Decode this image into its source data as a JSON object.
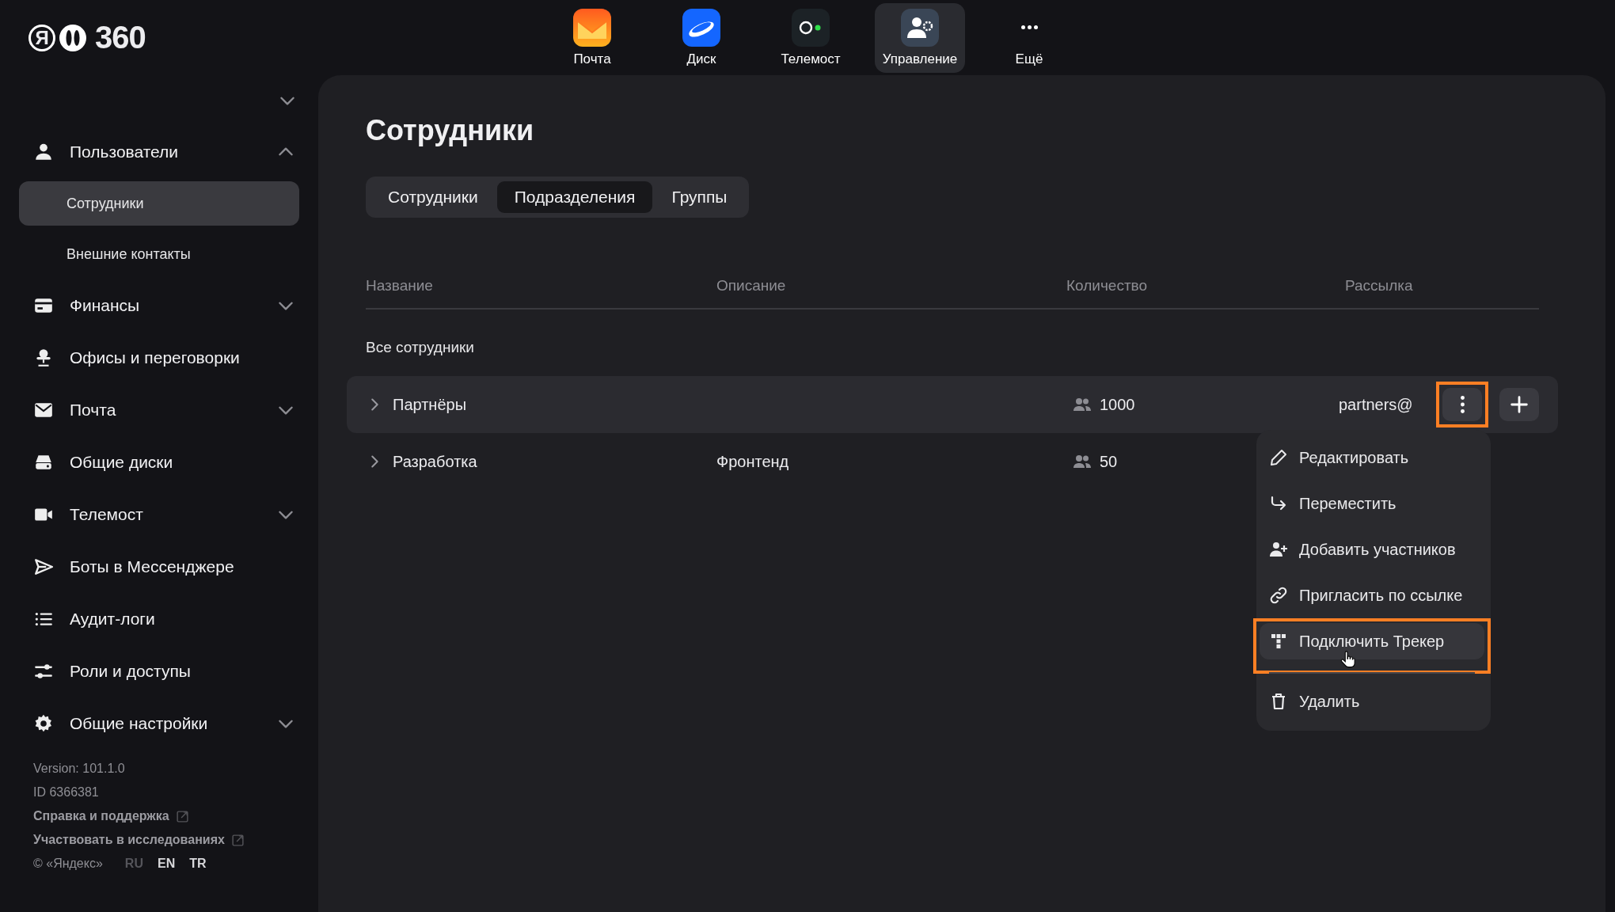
{
  "header": {
    "logo": {
      "letter": "Я",
      "text": "360"
    },
    "apps": [
      {
        "label": "Почта",
        "selected": false
      },
      {
        "label": "Диск",
        "selected": false
      },
      {
        "label": "Телемост",
        "selected": false
      },
      {
        "label": "Управление",
        "selected": true
      },
      {
        "label": "Ещё",
        "selected": false
      }
    ]
  },
  "sidebar": {
    "items": [
      {
        "label": "Пользователи",
        "kind": "group",
        "expanded": true,
        "children": [
          {
            "label": "Сотрудники",
            "selected": true
          },
          {
            "label": "Внешние контакты",
            "selected": false
          }
        ]
      },
      {
        "label": "Финансы",
        "kind": "group",
        "expanded": false
      },
      {
        "label": "Офисы и переговорки",
        "kind": "link"
      },
      {
        "label": "Почта",
        "kind": "group",
        "expanded": false
      },
      {
        "label": "Общие диски",
        "kind": "link"
      },
      {
        "label": "Телемост",
        "kind": "group",
        "expanded": false
      },
      {
        "label": "Боты в Мессенджере",
        "kind": "link"
      },
      {
        "label": "Аудит-логи",
        "kind": "link"
      },
      {
        "label": "Роли и доступы",
        "kind": "link"
      },
      {
        "label": "Общие настройки",
        "kind": "group",
        "expanded": false
      }
    ],
    "footer": {
      "version": "Version: 101.1.0",
      "id": "ID 6366381",
      "links": [
        {
          "label": "Справка и поддержка",
          "external": true
        },
        {
          "label": "Участвовать в исследованиях",
          "external": true
        }
      ],
      "copyright": "© «Яндекс»",
      "languages": [
        {
          "label": "RU",
          "selected": true
        },
        {
          "label": "EN",
          "selected": false
        },
        {
          "label": "TR",
          "selected": false
        }
      ]
    }
  },
  "main": {
    "title": "Сотрудники",
    "tabs": [
      {
        "label": "Сотрудники",
        "selected": false
      },
      {
        "label": "Подразделения",
        "selected": true
      },
      {
        "label": "Группы",
        "selected": false
      }
    ],
    "table": {
      "columns": [
        "Название",
        "Описание",
        "Количество",
        "Рассылка"
      ],
      "group_label": "Все сотрудники",
      "rows": [
        {
          "name": "Партнёры",
          "description": "",
          "count": "1000",
          "mailing": "partners@",
          "hovered": true,
          "annotated": true,
          "menu": [
            {
              "label": "Редактировать",
              "selected": false,
              "separated": false,
              "annotated": false
            },
            {
              "label": "Переместить",
              "selected": false,
              "separated": false,
              "annotated": false
            },
            {
              "label": "Добавить участников",
              "selected": false,
              "separated": false,
              "annotated": false
            },
            {
              "label": "Пригласить по ссылке",
              "selected": false,
              "separated": false,
              "annotated": false
            },
            {
              "label": "Подключить Трекер",
              "selected": true,
              "separated": false,
              "annotated": true
            },
            {
              "label": "Удалить",
              "selected": false,
              "separated": true,
              "annotated": false
            }
          ]
        },
        {
          "name": "Разработка",
          "description": "Фронтенд",
          "count": "50",
          "mailing": "",
          "hovered": false
        }
      ]
    }
  }
}
